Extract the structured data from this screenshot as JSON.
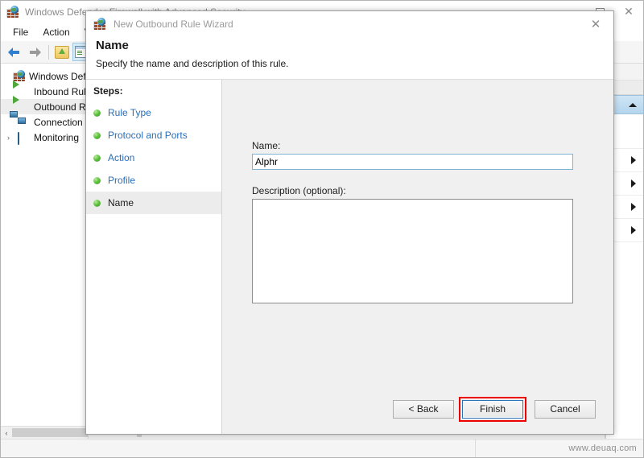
{
  "main_window": {
    "title": "Windows Defender Firewall with Advanced Security",
    "icon": "firewall-globe-icon",
    "window_buttons": {
      "minimize": "minimize-icon",
      "maximize": "maximize-icon",
      "close": "close-icon"
    },
    "menu": [
      {
        "label": "File"
      },
      {
        "label": "Action"
      },
      {
        "label": "View"
      }
    ],
    "toolbar": [
      {
        "name": "back-button",
        "icon": "arrow-left-icon"
      },
      {
        "name": "forward-button",
        "icon": "arrow-right-icon"
      },
      {
        "name": "show-hide-tree-button",
        "icon": "folder-icon"
      },
      {
        "name": "show-hide-console-tree-button",
        "icon": "console-window-icon"
      },
      {
        "name": "properties-button",
        "icon": "properties-icon"
      }
    ],
    "tree": [
      {
        "label": "Windows Defender",
        "icon": "firewall-icon",
        "expander": "",
        "selected": false
      },
      {
        "label": "Inbound Rule",
        "icon": "inbound-rules-icon",
        "expander": "",
        "selected": false
      },
      {
        "label": "Outbound Ru",
        "icon": "outbound-rules-icon",
        "expander": "",
        "selected": true
      },
      {
        "label": "Connection S",
        "icon": "connection-security-icon",
        "expander": "",
        "selected": false
      },
      {
        "label": "Monitoring",
        "icon": "monitoring-icon",
        "expander": "›",
        "selected": false
      }
    ],
    "status_bar": {
      "watermark": "www.deuaq.com"
    }
  },
  "wizard": {
    "title": "New Outbound Rule Wizard",
    "icon": "firewall-globe-icon",
    "close_label": "✕",
    "heading": "Name",
    "subheading": "Specify the name and description of this rule.",
    "steps_label": "Steps:",
    "steps": [
      {
        "label": "Rule Type",
        "current": false
      },
      {
        "label": "Protocol and Ports",
        "current": false
      },
      {
        "label": "Action",
        "current": false
      },
      {
        "label": "Profile",
        "current": false
      },
      {
        "label": "Name",
        "current": true
      }
    ],
    "form": {
      "name_label": "Name:",
      "name_value": "Alphr",
      "name_placeholder": "",
      "description_label": "Description (optional):",
      "description_value": "",
      "description_placeholder": ""
    },
    "buttons": {
      "back": "< Back",
      "finish": "Finish",
      "cancel": "Cancel"
    },
    "highlight_color": "#ee0000"
  }
}
